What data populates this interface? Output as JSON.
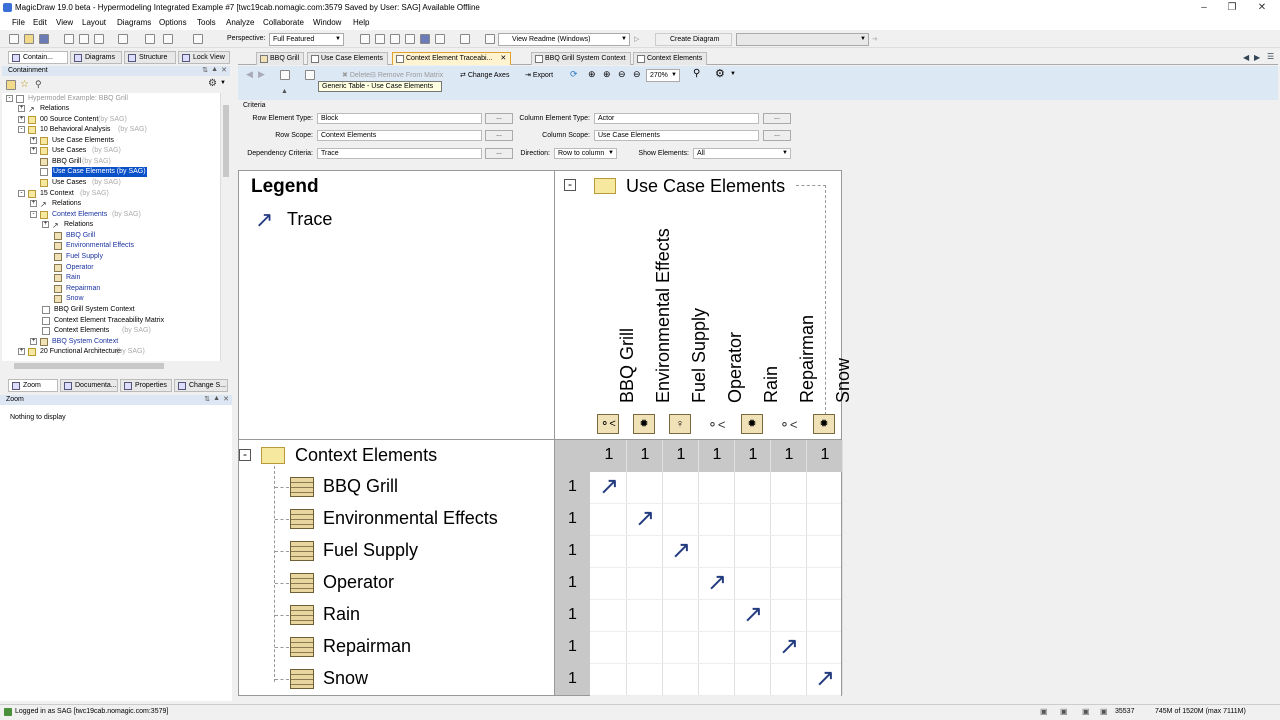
{
  "window": {
    "title": "MagicDraw 19.0 beta - Hypermodeling Integrated Example #7 [twc19cab.nomagic.com:3579 Saved by User: SAG]  Available Offline"
  },
  "menu": [
    "File",
    "Edit",
    "View",
    "Layout",
    "Diagrams",
    "Options",
    "Tools",
    "Analyze",
    "Collaborate",
    "Window",
    "Help"
  ],
  "toolbar": {
    "perspective_label": "Perspective:",
    "perspective_value": "Full Featured",
    "view_readme": "View Readme (Windows)",
    "create_diagram": "Create Diagram"
  },
  "left_tabs": [
    "Contain...",
    "Diagrams",
    "Structure",
    "Lock View"
  ],
  "containment": {
    "title": "Containment",
    "tree": [
      {
        "label": "Hypermodel Example: BBQ Grill",
        "suffix": "",
        "gray": true
      },
      {
        "label": "Relations",
        "suffix": ""
      },
      {
        "label": "00 Source Content",
        "suffix": "(by SAG)"
      },
      {
        "label": "10 Behavioral Analysis",
        "suffix": "(by SAG)"
      },
      {
        "label": "Use Case Elements",
        "suffix": ""
      },
      {
        "label": "Use Cases",
        "suffix": "(by SAG)"
      },
      {
        "label": "BBQ Grill",
        "suffix": "(by SAG)"
      },
      {
        "label": "Use Case Elements (by SAG)",
        "suffix": ""
      },
      {
        "label": "Use Cases",
        "suffix": "(by SAG)"
      },
      {
        "label": "15 Context",
        "suffix": "(by SAG)"
      },
      {
        "label": "Relations",
        "suffix": ""
      },
      {
        "label": "Context Elements",
        "suffix": "(by SAG)"
      },
      {
        "label": "Relations",
        "suffix": ""
      },
      {
        "label": "BBQ Grill",
        "suffix": ""
      },
      {
        "label": "Environmental Effects",
        "suffix": ""
      },
      {
        "label": "Fuel Supply",
        "suffix": ""
      },
      {
        "label": "Operator",
        "suffix": ""
      },
      {
        "label": "Rain",
        "suffix": ""
      },
      {
        "label": "Repairman",
        "suffix": ""
      },
      {
        "label": "Snow",
        "suffix": ""
      },
      {
        "label": "BBQ Grill System Context",
        "suffix": ""
      },
      {
        "label": "Context Element Traceability Matrix",
        "suffix": ""
      },
      {
        "label": "Context Elements",
        "suffix": "(by SAG)"
      },
      {
        "label": "BBQ System Context",
        "suffix": ""
      },
      {
        "label": "20 Functional Architecture",
        "suffix": "(by SAG)"
      }
    ]
  },
  "bottom_tabs": [
    "Zoom",
    "Documenta...",
    "Properties",
    "Change S..."
  ],
  "zoom": {
    "title": "Zoom",
    "empty": "Nothing to display"
  },
  "editor_tabs": [
    "BBQ Grill",
    "Use Case Elements",
    "Context Element Traceabi...",
    "BBQ Grill System Context",
    "Context Elements"
  ],
  "tooltip": "Generic Table - Use Case Elements",
  "matrix_toolbar": {
    "delete": "Delete",
    "remove": "Remove From Matrix",
    "change_axes": "Change Axes",
    "export": "Export",
    "zoom": "270%"
  },
  "criteria": {
    "title": "Criteria",
    "row_type_label": "Row Element Type:",
    "row_type": "Block",
    "col_type_label": "Column Element Type:",
    "col_type": "Actor",
    "row_scope_label": "Row Scope:",
    "row_scope": "Context Elements",
    "col_scope_label": "Column Scope:",
    "col_scope": "Use Case Elements",
    "dep_label": "Dependency Criteria:",
    "dep": "Trace",
    "direction_label": "Direction:",
    "direction": "Row to column",
    "show_label": "Show Elements:",
    "show": "All",
    "dots": "..."
  },
  "matrix": {
    "legend_title": "Legend",
    "legend_item": "Trace",
    "col_group": "Use Case Elements",
    "row_group": "Context Elements",
    "columns": [
      "BBQ Grill",
      "Environmental Effects",
      "Fuel Supply",
      "Operator",
      "Rain",
      "Repairman",
      "Snow"
    ],
    "col_counts": [
      "1",
      "1",
      "1",
      "1",
      "1",
      "1",
      "1"
    ],
    "rows": [
      "BBQ Grill",
      "Environmental Effects",
      "Fuel Supply",
      "Operator",
      "Rain",
      "Repairman",
      "Snow"
    ],
    "row_counts": [
      "1",
      "1",
      "1",
      "1",
      "1",
      "1",
      "1"
    ],
    "arrow": "↗"
  },
  "status": {
    "login": "Logged in as SAG [twc19cab.nomagic.com:3579]",
    "num": "35537",
    "memory": "745M of 1520M (max 7111M)"
  }
}
